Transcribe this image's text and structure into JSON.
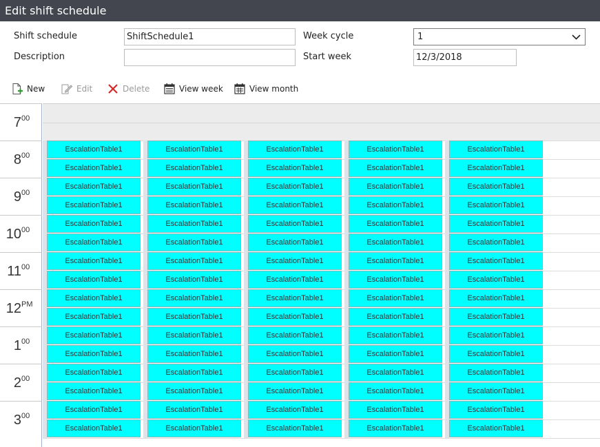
{
  "window": {
    "title": "Edit shift schedule"
  },
  "form": {
    "shift_schedule_label": "Shift schedule",
    "shift_schedule_value": "ShiftSchedule1",
    "description_label": "Description",
    "description_value": "",
    "week_cycle_label": "Week cycle",
    "week_cycle_value": "1",
    "start_week_label": "Start week",
    "start_week_value": "12/3/2018"
  },
  "toolbar": {
    "new_label": "New",
    "edit_label": "Edit",
    "delete_label": "Delete",
    "view_week_label": "View week",
    "view_month_label": "View month"
  },
  "calendar": {
    "hours": [
      {
        "num": "7",
        "sup": "00"
      },
      {
        "num": "8",
        "sup": "00"
      },
      {
        "num": "9",
        "sup": "00"
      },
      {
        "num": "10",
        "sup": "00"
      },
      {
        "num": "11",
        "sup": "00"
      },
      {
        "num": "12",
        "sup": "PM"
      },
      {
        "num": "1",
        "sup": "00"
      },
      {
        "num": "2",
        "sup": "00"
      },
      {
        "num": "3",
        "sup": "00"
      }
    ],
    "event_label": "EscalationTable1",
    "event_color": "#00ffff",
    "columns": 5,
    "slots_per_column": 16
  }
}
